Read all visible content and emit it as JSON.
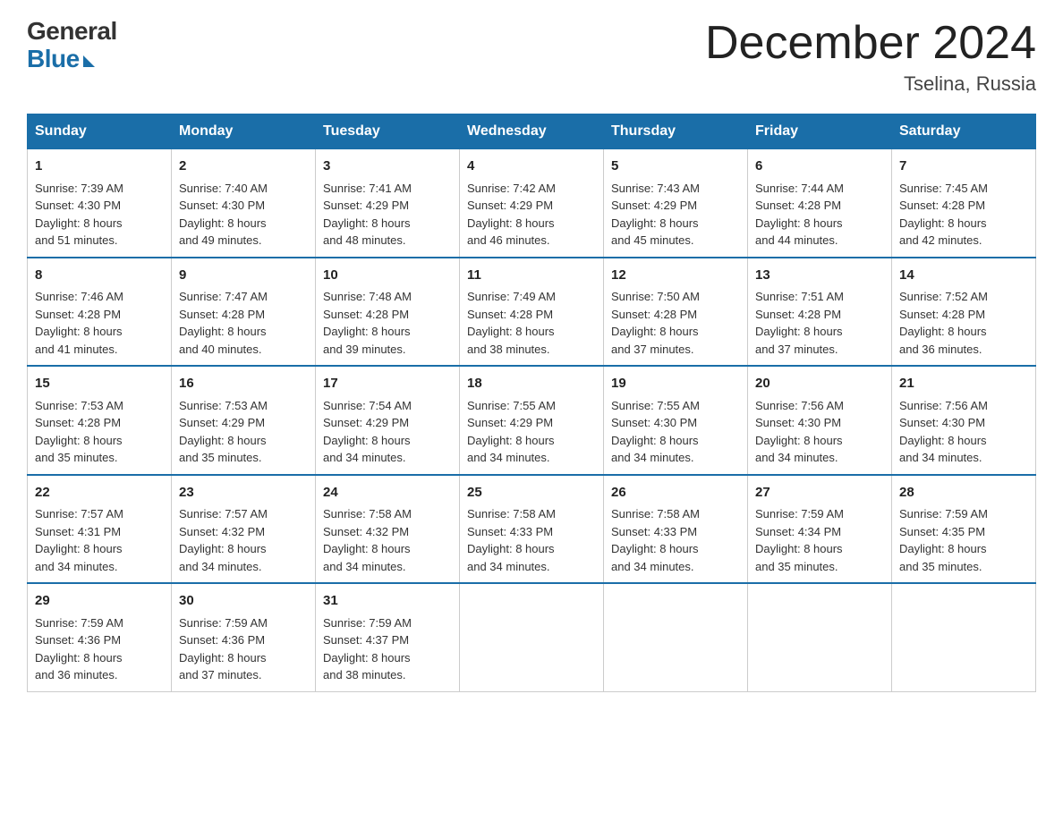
{
  "header": {
    "logo_general": "General",
    "logo_blue": "Blue",
    "month_title": "December 2024",
    "location": "Tselina, Russia"
  },
  "days_of_week": [
    "Sunday",
    "Monday",
    "Tuesday",
    "Wednesday",
    "Thursday",
    "Friday",
    "Saturday"
  ],
  "weeks": [
    [
      {
        "day": "1",
        "sunrise": "7:39 AM",
        "sunset": "4:30 PM",
        "daylight": "8 hours and 51 minutes."
      },
      {
        "day": "2",
        "sunrise": "7:40 AM",
        "sunset": "4:30 PM",
        "daylight": "8 hours and 49 minutes."
      },
      {
        "day": "3",
        "sunrise": "7:41 AM",
        "sunset": "4:29 PM",
        "daylight": "8 hours and 48 minutes."
      },
      {
        "day": "4",
        "sunrise": "7:42 AM",
        "sunset": "4:29 PM",
        "daylight": "8 hours and 46 minutes."
      },
      {
        "day": "5",
        "sunrise": "7:43 AM",
        "sunset": "4:29 PM",
        "daylight": "8 hours and 45 minutes."
      },
      {
        "day": "6",
        "sunrise": "7:44 AM",
        "sunset": "4:28 PM",
        "daylight": "8 hours and 44 minutes."
      },
      {
        "day": "7",
        "sunrise": "7:45 AM",
        "sunset": "4:28 PM",
        "daylight": "8 hours and 42 minutes."
      }
    ],
    [
      {
        "day": "8",
        "sunrise": "7:46 AM",
        "sunset": "4:28 PM",
        "daylight": "8 hours and 41 minutes."
      },
      {
        "day": "9",
        "sunrise": "7:47 AM",
        "sunset": "4:28 PM",
        "daylight": "8 hours and 40 minutes."
      },
      {
        "day": "10",
        "sunrise": "7:48 AM",
        "sunset": "4:28 PM",
        "daylight": "8 hours and 39 minutes."
      },
      {
        "day": "11",
        "sunrise": "7:49 AM",
        "sunset": "4:28 PM",
        "daylight": "8 hours and 38 minutes."
      },
      {
        "day": "12",
        "sunrise": "7:50 AM",
        "sunset": "4:28 PM",
        "daylight": "8 hours and 37 minutes."
      },
      {
        "day": "13",
        "sunrise": "7:51 AM",
        "sunset": "4:28 PM",
        "daylight": "8 hours and 37 minutes."
      },
      {
        "day": "14",
        "sunrise": "7:52 AM",
        "sunset": "4:28 PM",
        "daylight": "8 hours and 36 minutes."
      }
    ],
    [
      {
        "day": "15",
        "sunrise": "7:53 AM",
        "sunset": "4:28 PM",
        "daylight": "8 hours and 35 minutes."
      },
      {
        "day": "16",
        "sunrise": "7:53 AM",
        "sunset": "4:29 PM",
        "daylight": "8 hours and 35 minutes."
      },
      {
        "day": "17",
        "sunrise": "7:54 AM",
        "sunset": "4:29 PM",
        "daylight": "8 hours and 34 minutes."
      },
      {
        "day": "18",
        "sunrise": "7:55 AM",
        "sunset": "4:29 PM",
        "daylight": "8 hours and 34 minutes."
      },
      {
        "day": "19",
        "sunrise": "7:55 AM",
        "sunset": "4:30 PM",
        "daylight": "8 hours and 34 minutes."
      },
      {
        "day": "20",
        "sunrise": "7:56 AM",
        "sunset": "4:30 PM",
        "daylight": "8 hours and 34 minutes."
      },
      {
        "day": "21",
        "sunrise": "7:56 AM",
        "sunset": "4:30 PM",
        "daylight": "8 hours and 34 minutes."
      }
    ],
    [
      {
        "day": "22",
        "sunrise": "7:57 AM",
        "sunset": "4:31 PM",
        "daylight": "8 hours and 34 minutes."
      },
      {
        "day": "23",
        "sunrise": "7:57 AM",
        "sunset": "4:32 PM",
        "daylight": "8 hours and 34 minutes."
      },
      {
        "day": "24",
        "sunrise": "7:58 AM",
        "sunset": "4:32 PM",
        "daylight": "8 hours and 34 minutes."
      },
      {
        "day": "25",
        "sunrise": "7:58 AM",
        "sunset": "4:33 PM",
        "daylight": "8 hours and 34 minutes."
      },
      {
        "day": "26",
        "sunrise": "7:58 AM",
        "sunset": "4:33 PM",
        "daylight": "8 hours and 34 minutes."
      },
      {
        "day": "27",
        "sunrise": "7:59 AM",
        "sunset": "4:34 PM",
        "daylight": "8 hours and 35 minutes."
      },
      {
        "day": "28",
        "sunrise": "7:59 AM",
        "sunset": "4:35 PM",
        "daylight": "8 hours and 35 minutes."
      }
    ],
    [
      {
        "day": "29",
        "sunrise": "7:59 AM",
        "sunset": "4:36 PM",
        "daylight": "8 hours and 36 minutes."
      },
      {
        "day": "30",
        "sunrise": "7:59 AM",
        "sunset": "4:36 PM",
        "daylight": "8 hours and 37 minutes."
      },
      {
        "day": "31",
        "sunrise": "7:59 AM",
        "sunset": "4:37 PM",
        "daylight": "8 hours and 38 minutes."
      },
      null,
      null,
      null,
      null
    ]
  ]
}
